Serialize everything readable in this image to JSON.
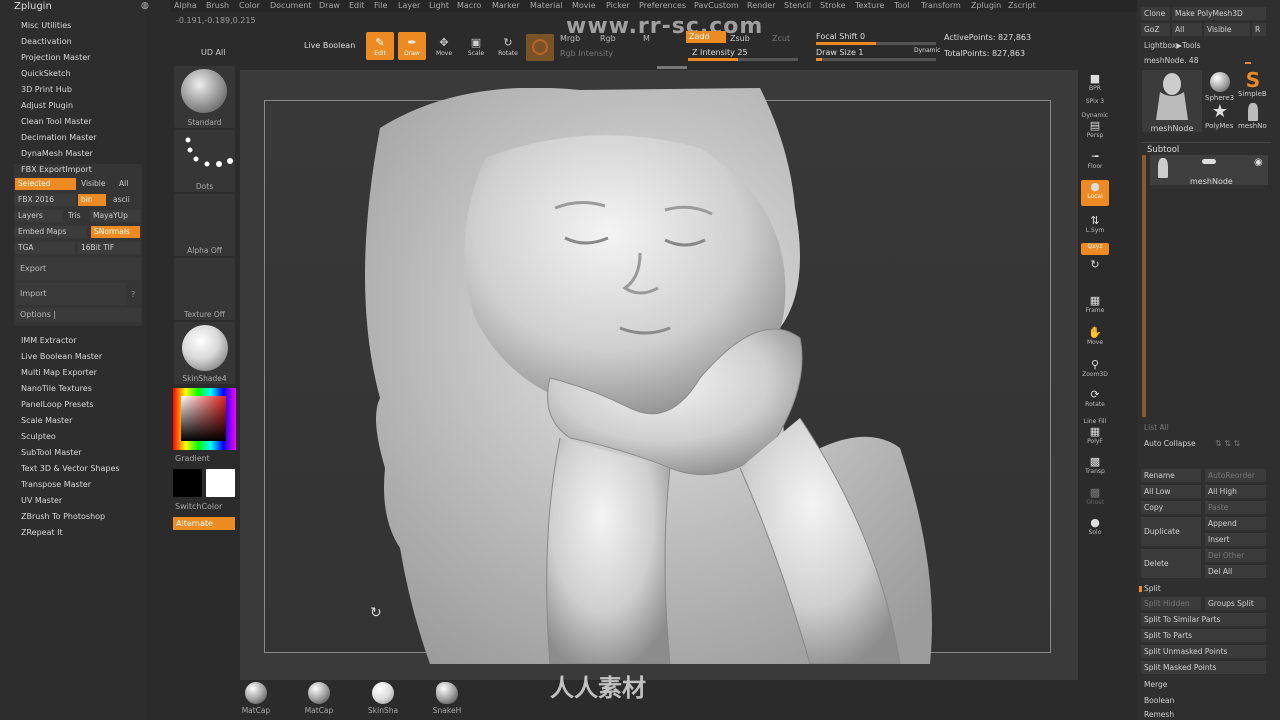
{
  "app": {
    "title": "ZBrush"
  },
  "menubar": [
    "Alpha",
    "Brush",
    "Color",
    "Document",
    "Draw",
    "Edit",
    "File",
    "Layer",
    "Light",
    "Macro",
    "Marker",
    "Material",
    "Movie",
    "Picker",
    "Preferences",
    "PavCustom",
    "Render",
    "Stencil",
    "Stroke",
    "Texture",
    "Tool",
    "Transform",
    "Zplugin",
    "Zscript"
  ],
  "coords": "-0.191,-0.189,0.215",
  "zplugin": {
    "title": "Zplugin",
    "items_top": [
      "Misc Utilities",
      "Deactivation",
      "Projection Master",
      "QuickSketch",
      "3D Print Hub",
      "Adjust Plugin",
      "Clean Tool Master",
      "Decimation Master",
      "DynaMesh Master",
      "FBX ExportImport"
    ],
    "fbx": {
      "selected": "Selected",
      "visible": "Visible",
      "all": "All",
      "fbx2016": "FBX 2016",
      "bin": "bin",
      "ascii": "ascii",
      "layers": "Layers",
      "tris": "Tris",
      "mayayup": "MayaYUp",
      "embed": "Embed Maps",
      "snormals": "SNormals",
      "tga": "TGA",
      "bittif": "16Bit TIF",
      "export": "Export",
      "import": "Import",
      "q": "?",
      "options": "Options |"
    },
    "items_bottom": [
      "IMM Extractor",
      "Live Boolean Master",
      "Multi Map Exporter",
      "NanoTile Textures",
      "PanelLoop Presets",
      "Scale Master",
      "Sculpteo",
      "SubTool Master",
      "Text 3D & Vector Shapes",
      "Transpose Master",
      "UV Master",
      "ZBrush To Photoshop",
      "ZRepeat It"
    ]
  },
  "shelf": {
    "udall": "UD All",
    "standard": "Standard",
    "dots": "Dots",
    "alpha": "Alpha Off",
    "texture": "Texture Off",
    "material": "SkinShade4",
    "gradient": "Gradient",
    "switchcolor": "SwitchColor",
    "alternate": "Alternate"
  },
  "toolbar": {
    "live_boolean": "Live Boolean",
    "edit": "Edit",
    "draw": "Draw",
    "move": "Move",
    "scale": "Scale",
    "rotate": "Rotate",
    "mrgb": "Mrgb",
    "rgb": "Rgb",
    "m": "M",
    "rgb_intensity": "Rgb Intensity",
    "zadd": "Zadd",
    "zsub": "Zsub",
    "zcut": "Zcut",
    "z_intensity": "Z Intensity 25",
    "focal_shift": "Focal Shift 0",
    "draw_size": "Draw Size 1",
    "dynamic": "Dynamic",
    "active_points": "ActivePoints: 827,863",
    "total_points": "TotalPoints: 827,863"
  },
  "rtools": {
    "bpr": "BPR",
    "spix": "SPix 3",
    "dynamic": "Dynamic",
    "persp": "Persp",
    "floor": "Floor",
    "local": "Local",
    "lsym": "L.Sym",
    "qxyz": "Qxyz",
    "frame": "Frame",
    "move": "Move",
    "zoom3d": "Zoom3D",
    "rotate": "Rotate",
    "linefill": "Line Fill",
    "polyf": "PolyF",
    "transp": "Transp",
    "ghost": "Ghost",
    "solo": "Solo"
  },
  "rpanel": {
    "clone": "Clone",
    "make_polymesh": "Make PolyMesh3D",
    "goz": "GoZ",
    "all": "All",
    "visible": "Visible",
    "r": "R",
    "lightbox": "Lightbox▶Tools",
    "meshnode_value": "meshNode. 48",
    "thumbs": [
      "meshNode",
      "Sphere3",
      "SimpleB",
      "PolyMes",
      "meshNo"
    ],
    "subtool_title": "Subtool",
    "subtool_item": "meshNode",
    "list_all": "List All",
    "auto_collapse": "Auto Collapse",
    "rename": "Rename",
    "autoreorder": "AutoReorder",
    "all_low": "All Low",
    "all_high": "All High",
    "copy": "Copy",
    "paste": "Paste",
    "duplicate": "Duplicate",
    "append": "Append",
    "insert": "Insert",
    "delete": "Delete",
    "del_other": "Del Other",
    "del_all": "Del All",
    "split": "Split",
    "split_hidden": "Split Hidden",
    "groups_split": "Groups Split",
    "split_similar": "Split To Similar Parts",
    "split_parts": "Split To Parts",
    "split_unmasked": "Split Unmasked Points",
    "split_masked": "Split Masked Points",
    "merge": "Merge",
    "boolean": "Boolean",
    "remesh": "Remesh"
  },
  "materials": [
    "MatCap",
    "MatCap",
    "SkinSha",
    "SnakeH"
  ],
  "watermark": "www.rr-sc.com",
  "logo_bottom": "人人素材",
  "colors": {
    "accent": "#ee8a22",
    "panel": "#2d2d2d",
    "viewport": "#3a3a3a"
  }
}
